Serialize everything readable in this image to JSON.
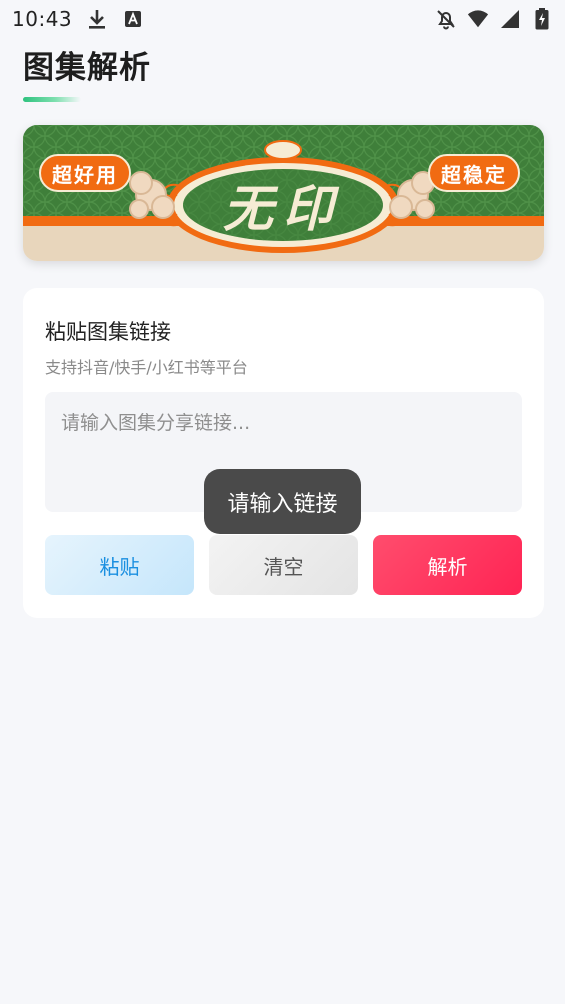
{
  "status_bar": {
    "time": "10:43",
    "left_icons": [
      "download-icon",
      "text-a-icon"
    ],
    "right_icons": [
      "notifications-off-icon",
      "wifi-icon",
      "cell-signal-icon",
      "battery-charging-icon"
    ]
  },
  "header": {
    "title": "图集解析",
    "underline_colors": [
      "#2ec27e",
      "#7ddfae"
    ]
  },
  "banner": {
    "left_badge": "超好用",
    "center_text": "无印",
    "right_badge": "超稳定",
    "colors": {
      "green": "#3f7f3a",
      "orange": "#f16b12",
      "beige": "#e8d6bc",
      "cream": "#f6ecd4"
    }
  },
  "card": {
    "title": "粘贴图集链接",
    "subtitle": "支持抖音/快手/小红书等平台",
    "input": {
      "value": "",
      "placeholder": "请输入图集分享链接..."
    },
    "buttons": {
      "paste_label": "粘贴",
      "clear_label": "清空",
      "parse_label": "解析"
    }
  },
  "toast": {
    "message": "请输入链接"
  },
  "colors": {
    "background": "#f6f7fa",
    "accent_blue": "#1a8fe0",
    "accent_red": "#ff2d5a"
  }
}
